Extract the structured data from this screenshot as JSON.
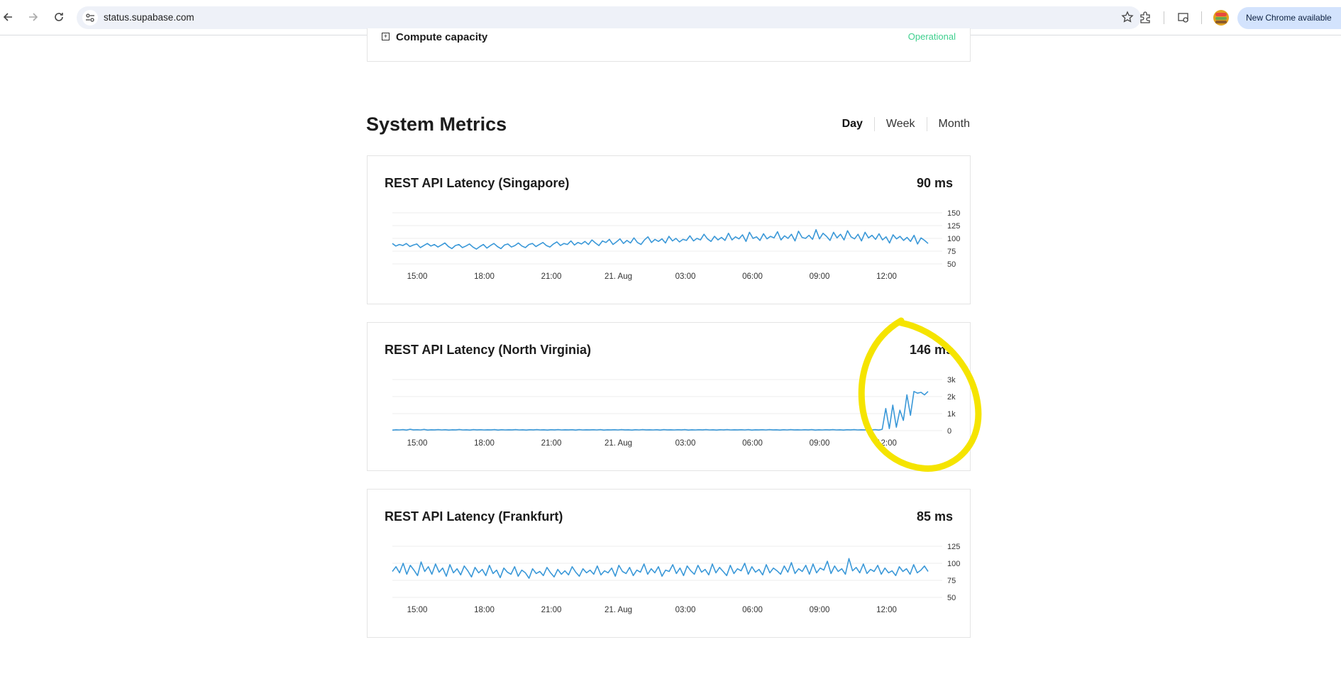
{
  "browser": {
    "url": "status.supabase.com",
    "update_label": "New Chrome available"
  },
  "component": {
    "name": "Compute capacity",
    "status": "Operational"
  },
  "section": {
    "title": "System Metrics",
    "tabs": [
      {
        "label": "Day",
        "active": true
      },
      {
        "label": "Week",
        "active": false
      },
      {
        "label": "Month",
        "active": false
      }
    ]
  },
  "metrics": [
    {
      "title": "REST API Latency (Singapore)",
      "value": "90 ms"
    },
    {
      "title": "REST API Latency (North Virginia)",
      "value": "146 ms"
    },
    {
      "title": "REST API Latency (Frankfurt)",
      "value": "85 ms"
    }
  ],
  "chart_data": [
    {
      "type": "line",
      "title": "REST API Latency (Singapore)",
      "x_ticks": [
        "15:00",
        "18:00",
        "21:00",
        "21. Aug",
        "03:00",
        "06:00",
        "09:00",
        "12:00"
      ],
      "y_ticks": [
        "150",
        "125",
        "100",
        "75",
        "50"
      ],
      "ylim": [
        50,
        150
      ],
      "series_color": "#3a98d8",
      "series": [
        {
          "values": [
            90,
            85,
            88,
            86,
            90,
            84,
            87,
            89,
            82,
            86,
            90,
            85,
            88,
            83,
            87,
            91,
            84,
            80,
            86,
            88,
            82,
            85,
            89,
            83,
            79,
            84,
            88,
            81,
            86,
            90,
            84,
            80,
            87,
            89,
            83,
            86,
            91,
            85,
            82,
            88,
            90,
            84,
            88,
            92,
            86,
            83,
            89,
            93,
            86,
            90,
            88,
            95,
            87,
            92,
            89,
            94,
            88,
            97,
            91,
            86,
            95,
            92,
            98,
            88,
            93,
            99,
            90,
            96,
            91,
            101,
            92,
            88,
            97,
            103,
            92,
            98,
            94,
            99,
            91,
            104,
            95,
            100,
            93,
            98,
            96,
            105,
            95,
            100,
            97,
            108,
            99,
            94,
            104,
            97,
            102,
            96,
            110,
            97,
            103,
            99,
            107,
            94,
            112,
            100,
            103,
            96,
            109,
            99,
            104,
            101,
            113,
            97,
            105,
            100,
            108,
            95,
            114,
            102,
            100,
            106,
            98,
            117,
            99,
            110,
            104,
            96,
            112,
            101,
            108,
            97,
            115,
            103,
            99,
            108,
            95,
            112,
            101,
            106,
            98,
            109,
            97,
            103,
            91,
            107,
            99,
            104,
            96,
            102,
            94,
            106,
            89,
            101,
            96,
            90
          ]
        }
      ]
    },
    {
      "type": "line",
      "title": "REST API Latency (North Virginia)",
      "x_ticks": [
        "15:00",
        "18:00",
        "21:00",
        "21. Aug",
        "03:00",
        "06:00",
        "09:00",
        "12:00"
      ],
      "y_ticks": [
        "3k",
        "2k",
        "1k",
        "0"
      ],
      "ylim": [
        0,
        3000
      ],
      "series_color": "#3a98d8",
      "series": [
        {
          "values": [
            30,
            50,
            40,
            60,
            35,
            80,
            45,
            55,
            40,
            70,
            35,
            50,
            45,
            60,
            40,
            55,
            35,
            50,
            45,
            65,
            40,
            50,
            35,
            60,
            45,
            55,
            40,
            50,
            45,
            60,
            35,
            55,
            40,
            50,
            45,
            60,
            40,
            50,
            35,
            55,
            45,
            60,
            40,
            50,
            35,
            55,
            45,
            60,
            40,
            50,
            45,
            55,
            35,
            60,
            40,
            50,
            45,
            55,
            40,
            60,
            35,
            50,
            45,
            55,
            40,
            60,
            45,
            50,
            35,
            55,
            40,
            60,
            45,
            50,
            40,
            55,
            35,
            60,
            45,
            50,
            40,
            55,
            45,
            60,
            35,
            50,
            40,
            55,
            45,
            60,
            40,
            50,
            35,
            55,
            45,
            60,
            40,
            50,
            45,
            55,
            40,
            60,
            35,
            50,
            45,
            55,
            40,
            60,
            45,
            50,
            35,
            55,
            40,
            60,
            45,
            50,
            40,
            55,
            45,
            60,
            35,
            50,
            40,
            55,
            45,
            60,
            40,
            50,
            35,
            55,
            45,
            60,
            40,
            50,
            45,
            55,
            40,
            60,
            35,
            80,
            1300,
            120,
            1500,
            200,
            1200,
            600,
            2100,
            900,
            2300,
            2200,
            2250,
            2100,
            2300
          ]
        }
      ]
    },
    {
      "type": "line",
      "title": "REST API Latency (Frankfurt)",
      "x_ticks": [
        "15:00",
        "18:00",
        "21:00",
        "21. Aug",
        "03:00",
        "06:00",
        "09:00",
        "12:00"
      ],
      "y_ticks": [
        "125",
        "100",
        "75",
        "50"
      ],
      "ylim": [
        50,
        125
      ],
      "series_color": "#3a98d8",
      "series": [
        {
          "values": [
            88,
            95,
            86,
            100,
            84,
            97,
            90,
            82,
            102,
            88,
            95,
            84,
            99,
            87,
            93,
            81,
            98,
            86,
            92,
            83,
            96,
            89,
            80,
            94,
            86,
            91,
            82,
            97,
            85,
            90,
            79,
            93,
            87,
            84,
            95,
            81,
            90,
            86,
            78,
            92,
            85,
            88,
            82,
            94,
            86,
            80,
            91,
            84,
            89,
            83,
            95,
            87,
            81,
            92,
            86,
            90,
            84,
            96,
            83,
            89,
            86,
            93,
            81,
            97,
            88,
            85,
            94,
            82,
            90,
            87,
            99,
            84,
            92,
            86,
            95,
            81,
            90,
            88,
            98,
            85,
            93,
            82,
            96,
            89,
            84,
            97,
            87,
            91,
            83,
            99,
            86,
            94,
            88,
            82,
            97,
            85,
            92,
            89,
            100,
            84,
            95,
            87,
            91,
            83,
            98,
            86,
            93,
            89,
            84,
            96,
            87,
            101,
            85,
            92,
            88,
            97,
            84,
            99,
            86,
            93,
            90,
            103,
            85,
            96,
            88,
            92,
            84,
            107,
            89,
            94,
            86,
            99,
            85,
            91,
            88,
            97,
            84,
            93,
            86,
            89,
            82,
            95,
            88,
            92,
            84,
            98,
            86,
            90,
            96,
            88
          ]
        }
      ]
    }
  ]
}
